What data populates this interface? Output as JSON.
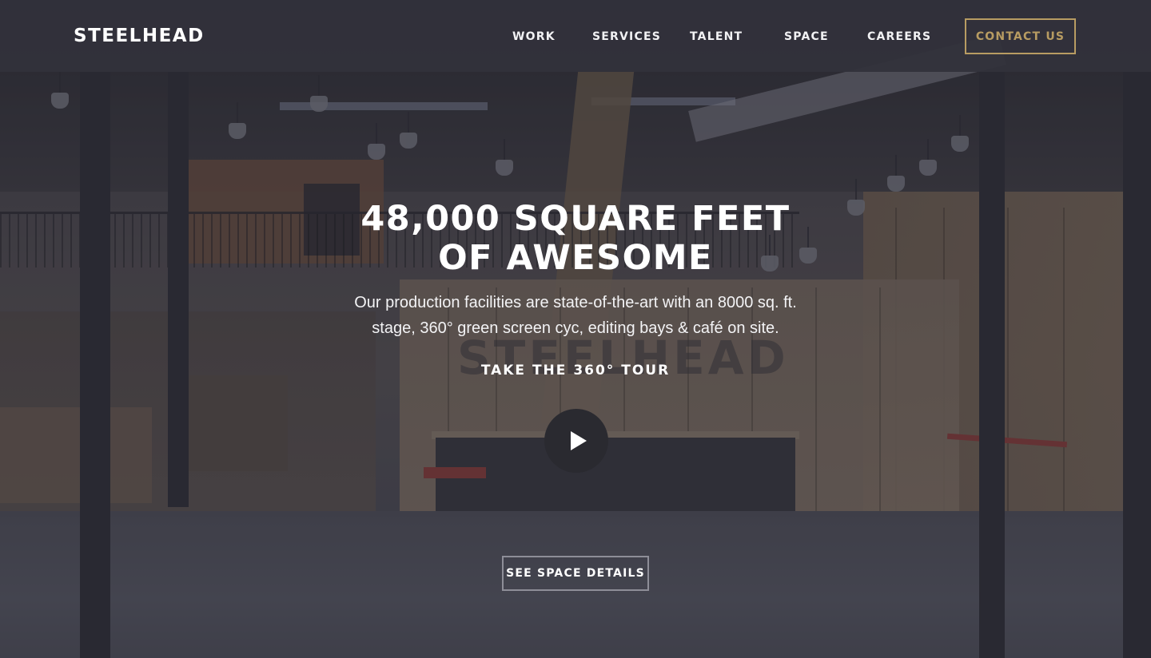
{
  "brand": {
    "logo_text": "STEELHEAD"
  },
  "nav": {
    "items": [
      {
        "label": "WORK"
      },
      {
        "label": "SERVICES"
      },
      {
        "label": "TALENT"
      },
      {
        "label": "SPACE"
      },
      {
        "label": "CAREERS"
      }
    ],
    "contact_label": "CONTACT US"
  },
  "hero": {
    "title_line1": "48,000 SQUARE FEET",
    "title_line2": "OF AWESOME",
    "description_line1": "Our production facilities are state-of-the-art with an 8000 sq. ft.",
    "description_line2": "stage, 360° green screen cyc, editing bays & café on site.",
    "tour_label": "TAKE THE 360° TOUR",
    "play_icon": "play-icon",
    "details_label": "SEE SPACE DETAILS",
    "background_sign_text": "STEELHEAD"
  },
  "colors": {
    "header_bg": "#30303a",
    "accent_gold": "#b89c62",
    "text_white": "#ffffff",
    "play_button_bg": "#2a2a30"
  }
}
